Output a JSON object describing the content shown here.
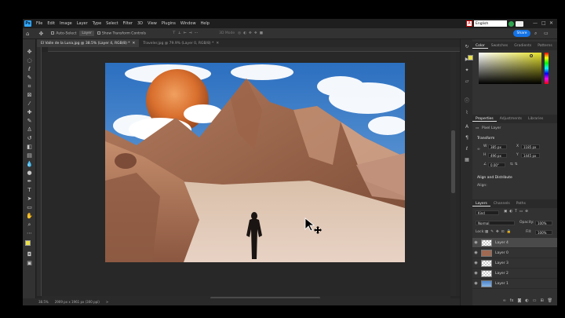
{
  "app": {
    "name": "Photoshop",
    "logo": "Ps"
  },
  "menu": [
    "File",
    "Edit",
    "Image",
    "Layer",
    "Type",
    "Select",
    "Filter",
    "3D",
    "View",
    "Plugins",
    "Window",
    "Help"
  ],
  "language": {
    "selected": "English"
  },
  "options_bar": {
    "auto_select": "Auto-Select",
    "layer_dropdown": "Layer",
    "transform_controls": "Show Transform Controls",
    "mode3d": "3D Mode",
    "share": "Share"
  },
  "tabs": [
    {
      "label": "El Valle de la Luna.jpg @ 38.5% (Layer 4, RGB/8) *",
      "active": true
    },
    {
      "label": "Traveler.jpg @ 79.9% (Layer 0, RGB/8) *",
      "active": false
    }
  ],
  "status": {
    "zoom": "38.5%",
    "doc": "2909 px x 1961 px (300 ppi)",
    "arrow": ">"
  },
  "color_panel": {
    "tabs": [
      "Color",
      "Swatches",
      "Gradients",
      "Patterns"
    ],
    "foreground": "#e9e14a",
    "background": "#111111"
  },
  "properties": {
    "tabs": [
      "Properties",
      "Adjustments",
      "Libraries"
    ],
    "kind": "Pixel Layer",
    "transform_title": "Transform",
    "w": "385 px",
    "h": "496 px",
    "x": "1185 px",
    "y": "1445 px",
    "angle": "0.00°",
    "align_title": "Align and Distribute",
    "align_sub": "Align:"
  },
  "layers_panel": {
    "tabs": [
      "Layers",
      "Channels",
      "Paths"
    ],
    "kind": "Kind",
    "blend": "Normal",
    "opacity_label": "Opacity:",
    "opacity": "100%",
    "lock_label": "Lock:",
    "fill_label": "Fill:",
    "fill": "100%",
    "layers": [
      {
        "name": "Layer 4",
        "selected": true
      },
      {
        "name": "Layer 0",
        "selected": false
      },
      {
        "name": "Layer 3",
        "selected": false
      },
      {
        "name": "Layer 2",
        "selected": false
      },
      {
        "name": "Layer 1",
        "selected": false
      }
    ]
  }
}
